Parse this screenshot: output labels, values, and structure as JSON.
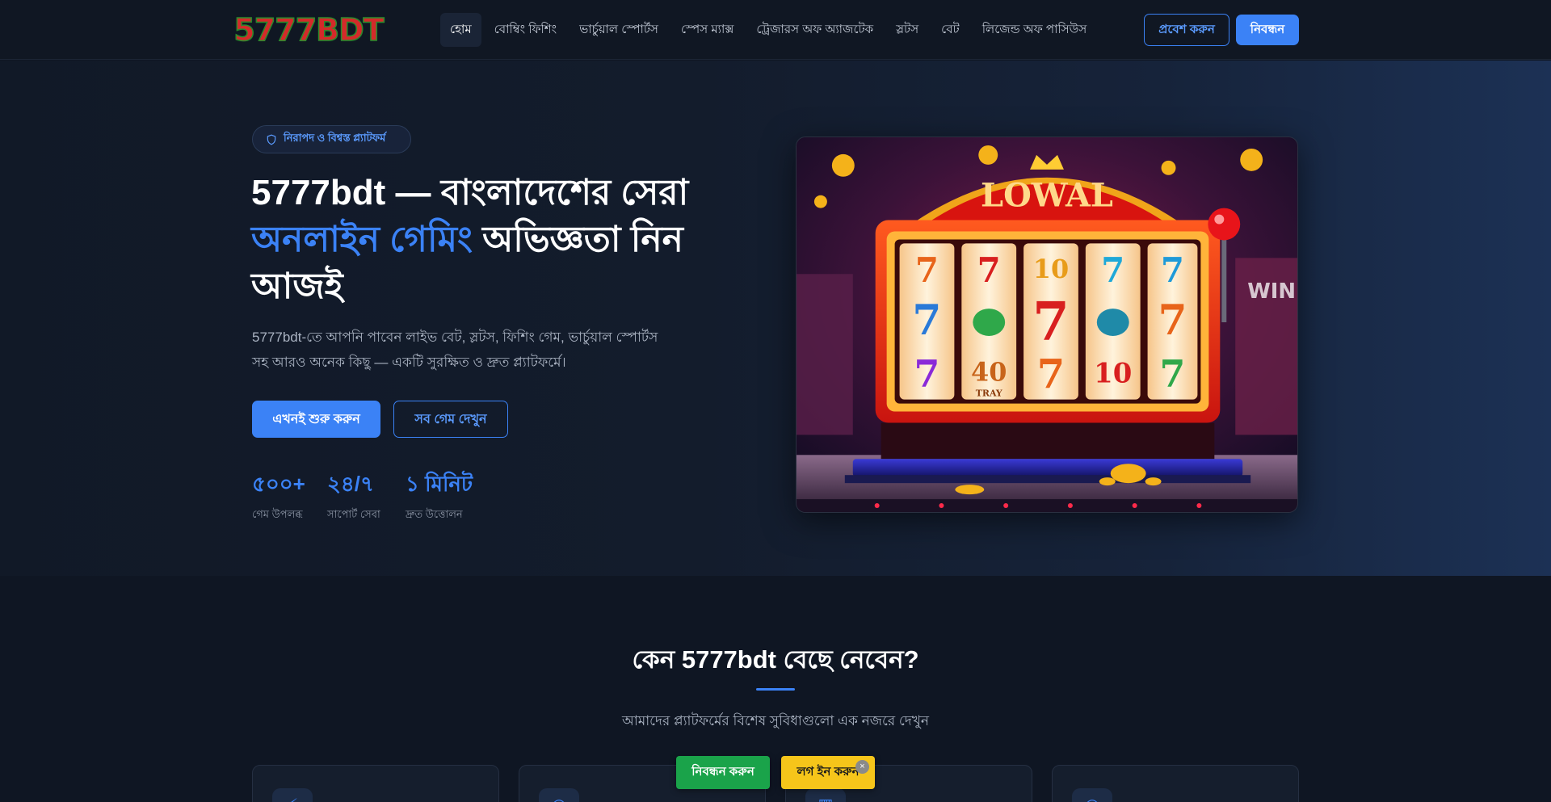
{
  "header": {
    "logo_text": "5777BDT",
    "nav": [
      {
        "label": "হোম"
      },
      {
        "label": "বোম্বিং ফিশিং"
      },
      {
        "label": "ভার্চুয়াল স্পোর্টস"
      },
      {
        "label": "স্পেস ম্যাক্স"
      },
      {
        "label": "ট্রেজারস অফ অ্যাজটেক"
      },
      {
        "label": "স্লটস"
      },
      {
        "label": "বেট"
      },
      {
        "label": "লিজেন্ড অফ পাসিউস"
      }
    ],
    "login_label": "প্রবেশ করুন",
    "register_label": "নিবন্ধন"
  },
  "hero": {
    "badge": "নিরাপদ ও বিশ্বস্ত প্ল্যাটফর্ম",
    "title_part1": "5777bdt — বাংলাদেশের সেরা",
    "title_accent": "অনলাইন গেমিং",
    "title_part2": "অভিজ্ঞতা নিন আজই",
    "description": "5777bdt-তে আপনি পাবেন লাইভ বেট, স্লটস, ফিশিং গেম, ভার্চুয়াল স্পোর্টস সহ আরও অনেক কিছু — একটি সুরক্ষিত ও দ্রুত প্ল্যাটফর্মে।",
    "start_label": "এখনই শুরু করুন",
    "all_games_label": "সব গেম দেখুন",
    "stats": [
      {
        "value": "৫০০+",
        "label": "গেম উপলব্ধ"
      },
      {
        "value": "২৪/৭",
        "label": "সাপোর্ট সেবা"
      },
      {
        "value": "১ মিনিট",
        "label": "দ্রুত উত্তোলন"
      }
    ],
    "image": {
      "sign": "LOWAL",
      "reels": [
        [
          "7",
          "7",
          "10",
          "7",
          "7"
        ],
        [
          "7",
          "",
          "7",
          "",
          "7"
        ],
        [
          "7",
          "40",
          "7",
          "10",
          "7"
        ]
      ],
      "side_text": "WIN",
      "tray_text": "TRAY"
    }
  },
  "why": {
    "title": "কেন 5777bdt বেছে নেবেন?",
    "subtitle": "আমাদের প্ল্যাটফর্মের বিশেষ সুবিধাগুলো এক নজরে দেখুন"
  },
  "float_bar": {
    "register_label": "নিবন্ধন করুন",
    "login_label": "লগ ইন করুন",
    "close_glyph": "×"
  },
  "colors": {
    "accent": "#3b82f6",
    "register_green": "#1aa34a",
    "login_yellow": "#f6c51a"
  }
}
